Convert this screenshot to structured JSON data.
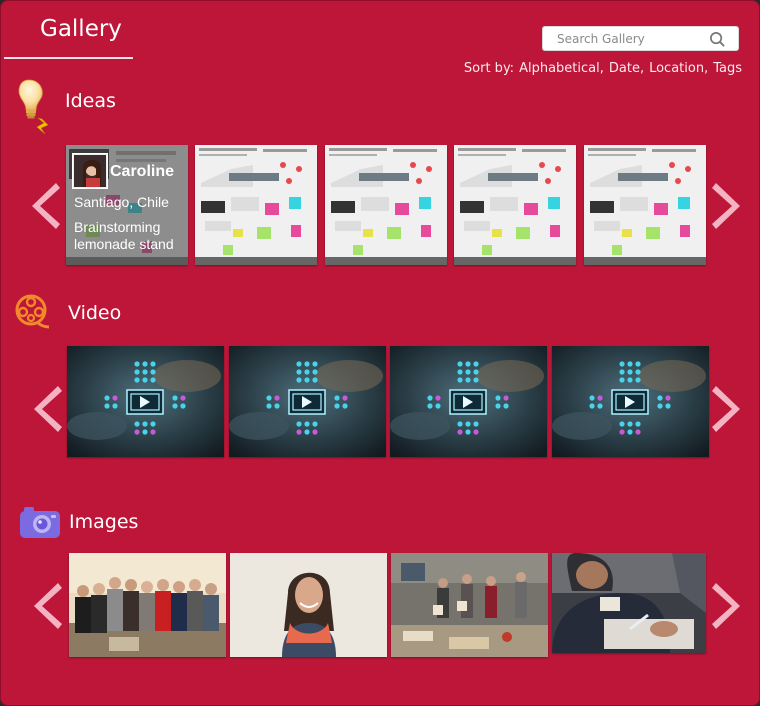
{
  "header": {
    "title": "Gallery"
  },
  "search": {
    "placeholder": "Search Gallery"
  },
  "sort": {
    "label": "Sort by:",
    "options": [
      "Alphabetical",
      "Date",
      "Location",
      "Tags"
    ]
  },
  "sections": {
    "ideas": {
      "title": "Ideas",
      "featured": {
        "name": "Caroline",
        "location": "Santiago, Chile",
        "description": "Brainstorming lemonade stand"
      }
    },
    "video": {
      "title": "Video"
    },
    "images": {
      "title": "Images"
    }
  },
  "colors": {
    "background": "#bd1639",
    "arrow": "#f3b3c2",
    "text": "#ffffff"
  },
  "icons": {
    "search": "search-icon",
    "ideas": "lightbulb-icon",
    "video": "film-reel-icon",
    "images": "camera-icon",
    "prev": "chevron-left-icon",
    "next": "chevron-right-icon"
  }
}
